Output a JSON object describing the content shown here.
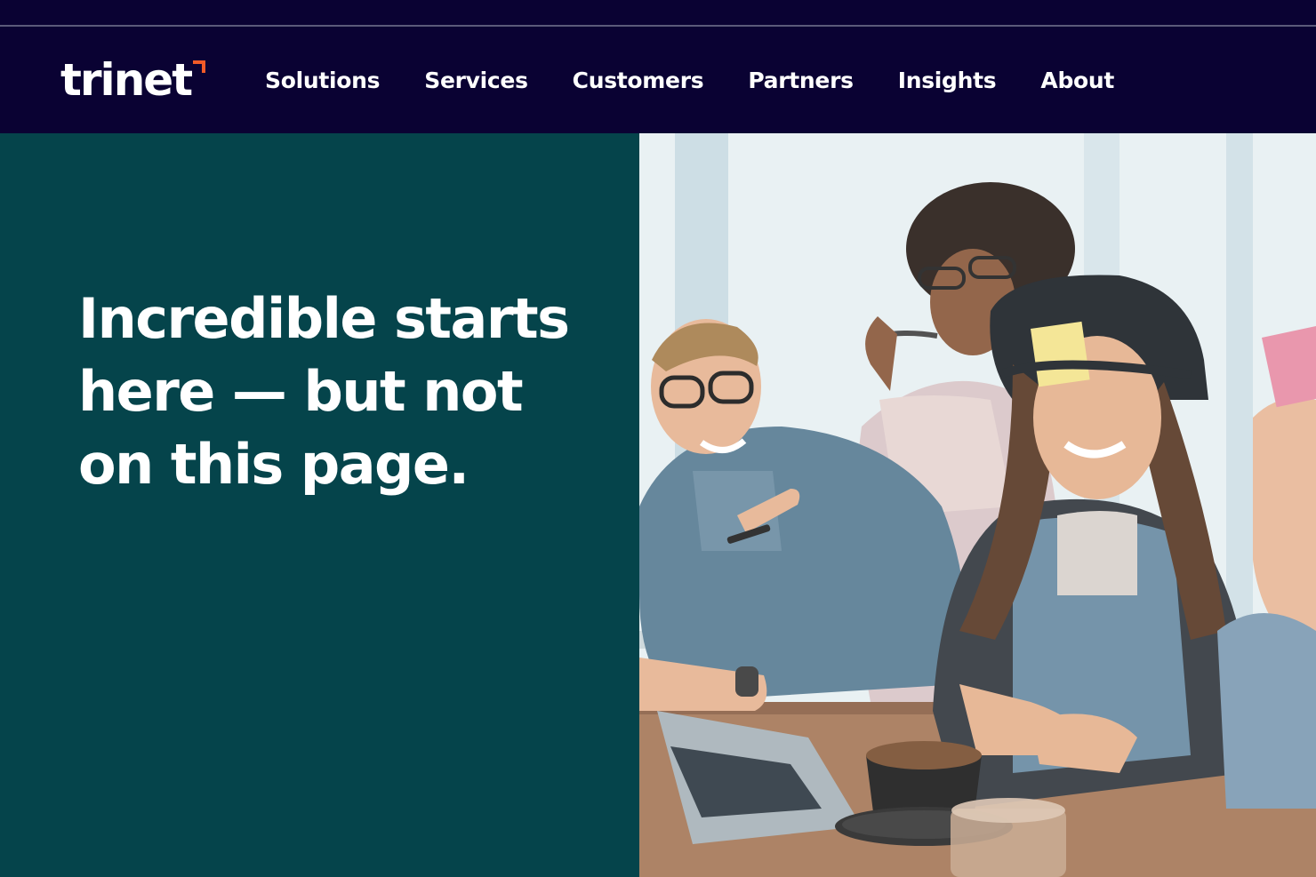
{
  "header": {
    "logo_text": "trinet",
    "nav": [
      {
        "label": "Solutions"
      },
      {
        "label": "Services"
      },
      {
        "label": "Customers"
      },
      {
        "label": "Partners"
      },
      {
        "label": "Insights"
      },
      {
        "label": "About"
      }
    ]
  },
  "hero": {
    "title": "Incredible starts here — but not on this page."
  },
  "colors": {
    "header_bg": "#0a0233",
    "hero_bg": "#05444b",
    "logo_accent": "#f05a28",
    "text": "#ffffff"
  }
}
